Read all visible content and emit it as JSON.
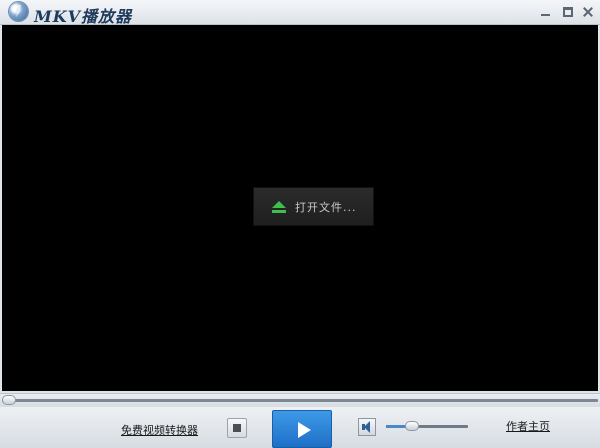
{
  "window": {
    "title": "MKV播放器"
  },
  "video": {
    "open_file_label": "打开文件..."
  },
  "controls": {
    "converter_link": "免费视频转换器",
    "author_link": "作者主页",
    "seek_position": 0,
    "volume_level": 0.32
  },
  "colors": {
    "accent_play": "#2f86d8",
    "eject_icon": "#3fbf4c",
    "video_background": "#000000"
  },
  "icons": [
    "app-logo-icon",
    "minimize-icon",
    "maximize-icon",
    "close-icon",
    "eject-icon",
    "stop-icon",
    "play-icon",
    "speaker-icon"
  ]
}
